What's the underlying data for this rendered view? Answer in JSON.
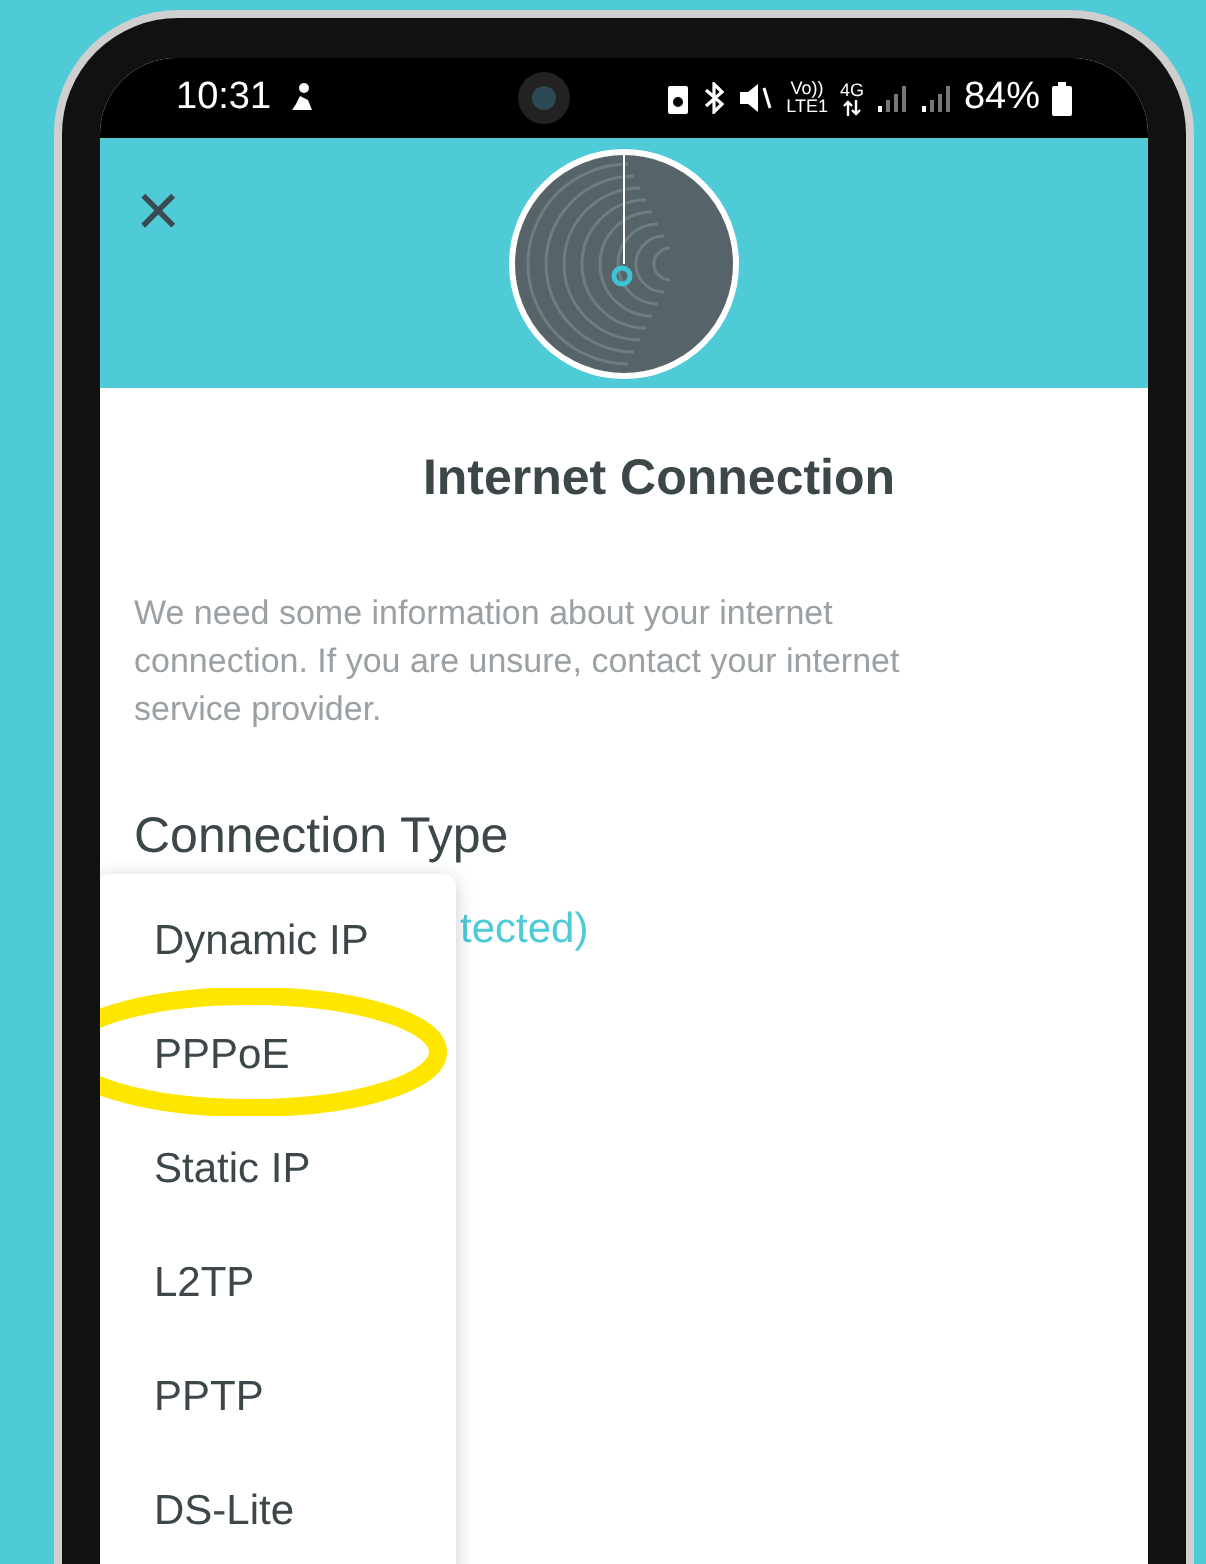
{
  "status_bar": {
    "time": "10:31",
    "volte": "Vo))",
    "lte": "LTE1",
    "network": "4G",
    "battery": "84%"
  },
  "header": {
    "close": "×"
  },
  "title": "Internet Connection",
  "description": "We need some information about your internet connection. If you are unsure, contact your internet service provider.",
  "connection_type": {
    "label": "Connection Type",
    "value": "tected)"
  },
  "menu": [
    {
      "label": "Dynamic IP",
      "circled": false
    },
    {
      "label": "PPPoE",
      "circled": true
    },
    {
      "label": "Static IP",
      "circled": false
    },
    {
      "label": "L2TP",
      "circled": false
    },
    {
      "label": "PPTP",
      "circled": false
    },
    {
      "label": "DS-Lite",
      "circled": false
    }
  ]
}
